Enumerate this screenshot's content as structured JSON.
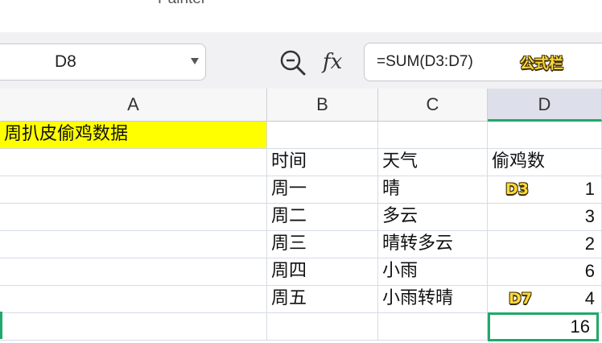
{
  "ribbon": {
    "painter_label": "Painter"
  },
  "formula_bar": {
    "cell_reference": "D8",
    "formula": "=SUM(D3:D7)",
    "annotation": "公式栏"
  },
  "columns": [
    "A",
    "B",
    "C",
    "D"
  ],
  "selected_column": "D",
  "sheet": {
    "title": "周扒皮偷鸡数据",
    "headers": {
      "time": "时间",
      "weather": "天气",
      "count": "偷鸡数"
    },
    "rows": [
      {
        "time": "周一",
        "weather": "晴",
        "count": "1"
      },
      {
        "time": "周二",
        "weather": "多云",
        "count": "3"
      },
      {
        "time": "周三",
        "weather": "晴转多云",
        "count": "2"
      },
      {
        "time": "周四",
        "weather": "小雨",
        "count": "6"
      },
      {
        "time": "周五",
        "weather": "小雨转晴",
        "count": "4"
      }
    ],
    "total": "16"
  },
  "annotations": {
    "first_cell": "D3",
    "last_cell": "D7"
  },
  "colors": {
    "selection_green": "#22a86a",
    "title_fill": "#ffff00",
    "sticker_yellow": "#ffd93a"
  }
}
